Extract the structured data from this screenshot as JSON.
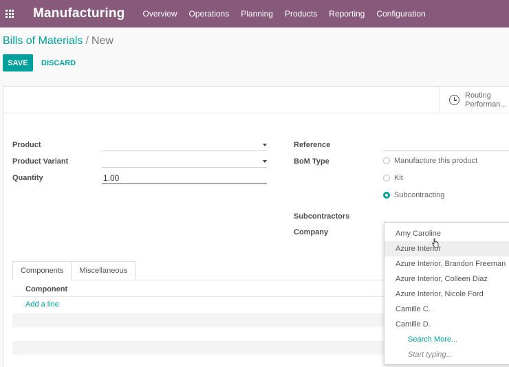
{
  "navbar": {
    "app_name": "Manufacturing",
    "menu": [
      "Overview",
      "Operations",
      "Planning",
      "Products",
      "Reporting",
      "Configuration"
    ],
    "apps_icon": "apps-grid-icon"
  },
  "breadcrumb": {
    "parent": "Bills of Materials",
    "separator": "/",
    "current": "New"
  },
  "actions": {
    "save": "SAVE",
    "discard": "DISCARD"
  },
  "smart_button": {
    "icon": "clock-icon",
    "line1": "Routing",
    "line2": "Performan..."
  },
  "form": {
    "product_label": "Product",
    "product_value": "",
    "variant_label": "Product Variant",
    "variant_value": "",
    "quantity_label": "Quantity",
    "quantity_value": "1.00",
    "reference_label": "Reference",
    "reference_value": "",
    "bom_type_label": "BoM Type",
    "bom_types": [
      {
        "label": "Manufacture this product",
        "checked": false
      },
      {
        "label": "Kit",
        "checked": false
      },
      {
        "label": "Subcontracting",
        "checked": true
      }
    ],
    "subcontractors_label": "Subcontractors",
    "company_label": "Company"
  },
  "tabs": {
    "components": "Components",
    "misc": "Miscellaneous"
  },
  "components_list": {
    "column": "Component",
    "add_line": "Add a line"
  },
  "dropdown": {
    "items": [
      "Amy Caroline",
      "Azure Interior",
      "Azure Interior, Brandon Freeman",
      "Azure Interior, Colleen Diaz",
      "Azure Interior, Nicole Ford",
      "Camille C.",
      "Camille D."
    ],
    "search_more": "Search More...",
    "hint": "Start typing..."
  },
  "colors": {
    "brand": "#875a7b",
    "accent": "#00a09d"
  }
}
